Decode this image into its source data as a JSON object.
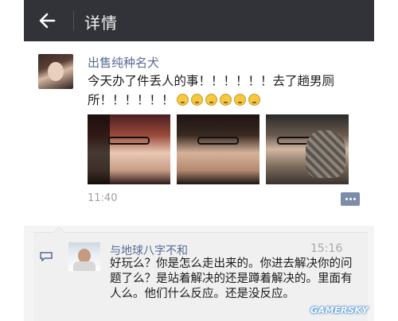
{
  "header": {
    "title": "详情"
  },
  "post": {
    "username": "出售纯种名犬",
    "text": "今天办了件丢人的事！！！！！！去了趟男厕所！！！！！！",
    "emoji_count": 6,
    "photo_count": 3,
    "time": "11:40"
  },
  "comment": {
    "username": "与地球八字不和",
    "time": "15:16",
    "text": "好玩么？你是怎么走出来的。你进去解决你的问题了么？是站着解决的还是蹲着解决的。里面有人么。他们什么反应。还是没反应。"
  },
  "watermark": "GAMERSKY",
  "colors": {
    "header_bg": "#323338",
    "link": "#576b95",
    "comment_bg": "#f0f0f0"
  }
}
